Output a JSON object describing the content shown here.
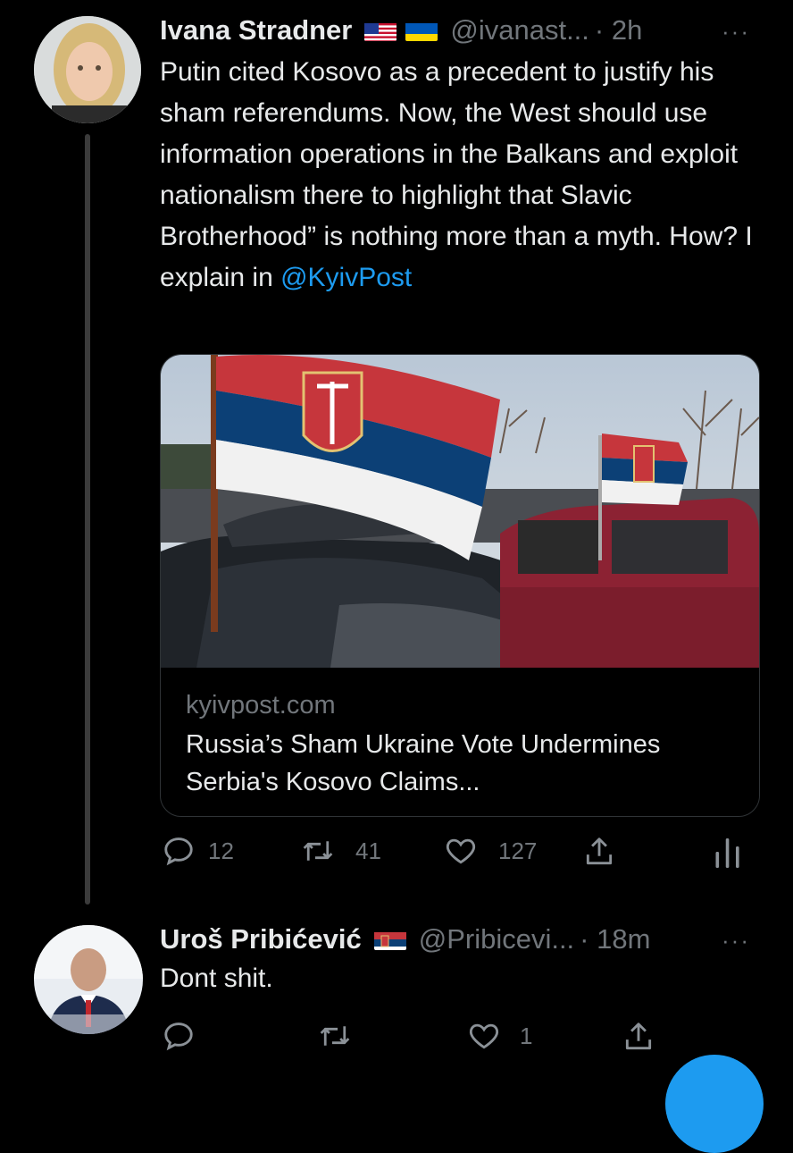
{
  "tweet": {
    "author_name": "Ivana Stradner",
    "flags": [
      "us-flag",
      "ukraine-flag"
    ],
    "handle": "@ivanast...",
    "time": "· 2h",
    "more": "···",
    "text_before": "Putin cited Kosovo as a precedent to justify his sham referendums. Now, the West should use information operations in the Balkans and exploit nationalism there to highlight that Slavic Brotherhood” is nothing more than a myth. How? I explain in ",
    "mention": "@KyivPost",
    "card": {
      "image": "serbian-flags-on-cars-photo",
      "domain": "kyivpost.com",
      "title": "Russia’s Sham Ukraine Vote Undermines Serbia's Kosovo Claims..."
    },
    "actions": {
      "replies": "12",
      "retweets": "41",
      "likes": "127"
    }
  },
  "reply": {
    "author_name": "Uroš Pribićević",
    "flags": [
      "serbia-flag"
    ],
    "handle": "@Pribicevi...",
    "time": "· 18m",
    "more": "···",
    "text": "Dont shit.",
    "actions": {
      "likes": "1"
    }
  },
  "colors": {
    "accent": "#1d9bf0",
    "muted": "#71767b",
    "text": "#e7e9ea",
    "background": "#000000"
  }
}
